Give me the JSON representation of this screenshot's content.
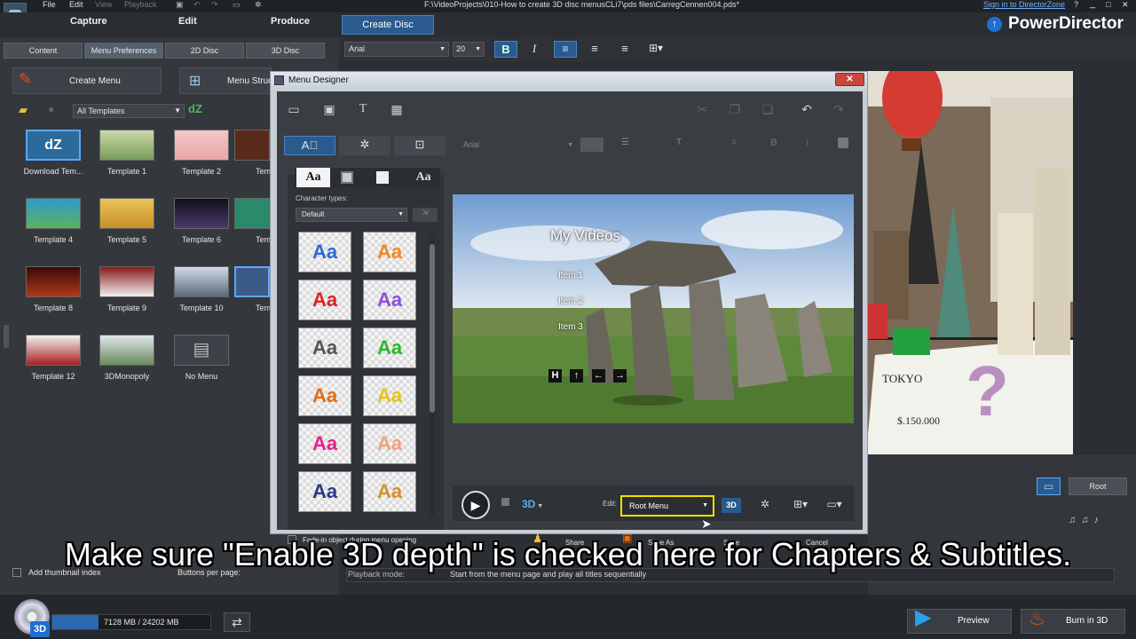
{
  "titlebar": {
    "menus": [
      "File",
      "Edit",
      "View",
      "Playback"
    ],
    "project_path": "F:\\VideoProjects\\010-How to create 3D disc menusCLi7\\pds files\\CarregCennen004.pds*",
    "signin_link": "Sign in to DirectorZone",
    "help": "?"
  },
  "nav": {
    "tabs": [
      "Capture",
      "Edit",
      "Produce",
      "Create Disc"
    ],
    "active_tab": "Create Disc",
    "brand": "PowerDirector"
  },
  "left_panel": {
    "subtabs": [
      "Content",
      "Menu Preferences",
      "2D Disc",
      "3D Disc"
    ],
    "active_subtab": "Menu Preferences",
    "create_menu_label": "Create Menu",
    "menu_structure_label": "Menu Struc",
    "template_filter": "All Templates",
    "templates": [
      {
        "label": "Download Tem..."
      },
      {
        "label": "Template 1"
      },
      {
        "label": "Template 2"
      },
      {
        "label": "Tem"
      },
      {
        "label": "Template 4"
      },
      {
        "label": "Template 5"
      },
      {
        "label": "Template 6"
      },
      {
        "label": "Tem"
      },
      {
        "label": "Template 8"
      },
      {
        "label": "Template 9"
      },
      {
        "label": "Template 10"
      },
      {
        "label": "Tem"
      },
      {
        "label": "Template 12"
      },
      {
        "label": "3DMonopoly"
      },
      {
        "label": "No Menu"
      }
    ],
    "add_thumbnail_index": "Add thumbnail index",
    "buttons_per_page": "Buttons per page:"
  },
  "font_toolbar": {
    "font": "Arial",
    "size": "20",
    "bold": "B",
    "italic": "I"
  },
  "dialog": {
    "title": "Menu Designer",
    "close": "✕",
    "font_placeholder": "Arial",
    "char_tab_labels": [
      "Aa",
      "",
      "",
      "Aa"
    ],
    "character_types_label": "Character types:",
    "character_type_value": "Default",
    "swatch_text": "Aa",
    "preview": {
      "title": "My Videos",
      "items": [
        "Item 1",
        "Item 2",
        "Item 3"
      ],
      "nav_buttons": [
        "H",
        "↑",
        "←",
        "→"
      ]
    },
    "edit_label": "Edit:",
    "edit_value": "Root Menu",
    "badge_3d": "3D",
    "fade_in_label": "Fade-in object during menu opening",
    "share_label": "Share",
    "save_as_label": "Save As",
    "save_label": "Save",
    "cancel_label": "Cancel"
  },
  "right_panel": {
    "root_label": "Root",
    "playback_mode_label": "Playback mode:",
    "playback_mode_value": "Start from the menu page and play all titles sequentially"
  },
  "bottom": {
    "disc_usage": "7128 MB / 24202 MB",
    "disc_usage_fraction": 0.294,
    "disc_badge": "3D",
    "preview_label": "Preview",
    "burn_label": "Burn in 3D"
  },
  "caption": "Make sure \"Enable 3D depth\" is checked here for Chapters & Subtitles.",
  "colors": {
    "accent": "#2b5a8e",
    "highlight": "#f0e000",
    "brand_blue": "#1e6fd1"
  }
}
